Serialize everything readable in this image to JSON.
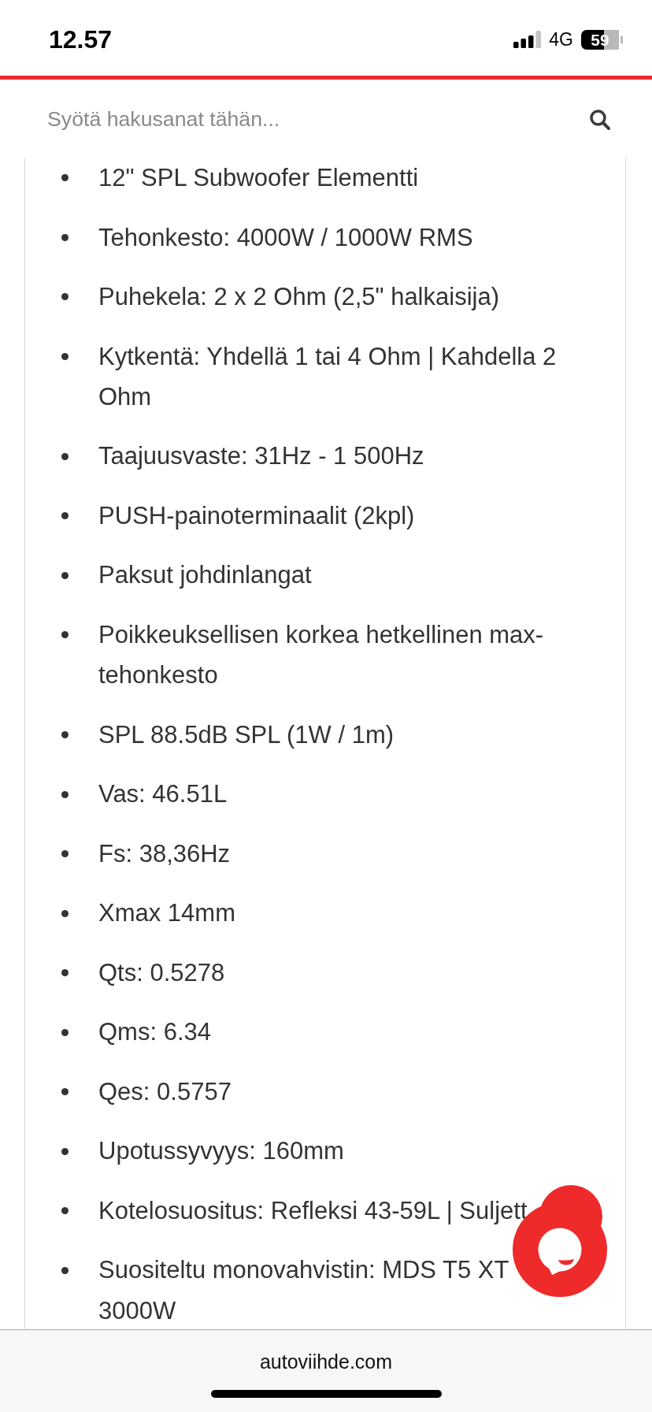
{
  "status_bar": {
    "time": "12.57",
    "network": "4G",
    "battery": "59"
  },
  "search": {
    "placeholder": "Syötä hakusanat tähän..."
  },
  "specs": [
    "12\" SPL Subwoofer Elementti",
    "Tehonkesto: 4000W / 1000W RMS",
    "Puhekela: 2 x 2 Ohm (2,5\" halkaisija)",
    "Kytkentä: Yhdellä 1 tai 4 Ohm | Kahdella 2 Ohm",
    "Taajuusvaste: 31Hz - 1 500Hz",
    "PUSH-painoterminaalit (2kpl)",
    "Paksut johdinlangat",
    "Poikkeuksellisen korkea hetkellinen max-tehonkesto",
    "SPL 88.5dB SPL (1W / 1m)",
    "Vas: 46.51L",
    "Fs: 38,36Hz",
    "Xmax 14mm",
    "Qts: 0.5278",
    "Qms: 6.34",
    "Qes: 0.5757",
    "Upotussyvyys: 160mm",
    "Kotelosuositus: Refleksi 43-59L | Suljett",
    "Suositeltu monovahvistin: MDS T5 XT 3000W"
  ],
  "browser_bar": {
    "url": "autoviihde.com"
  }
}
